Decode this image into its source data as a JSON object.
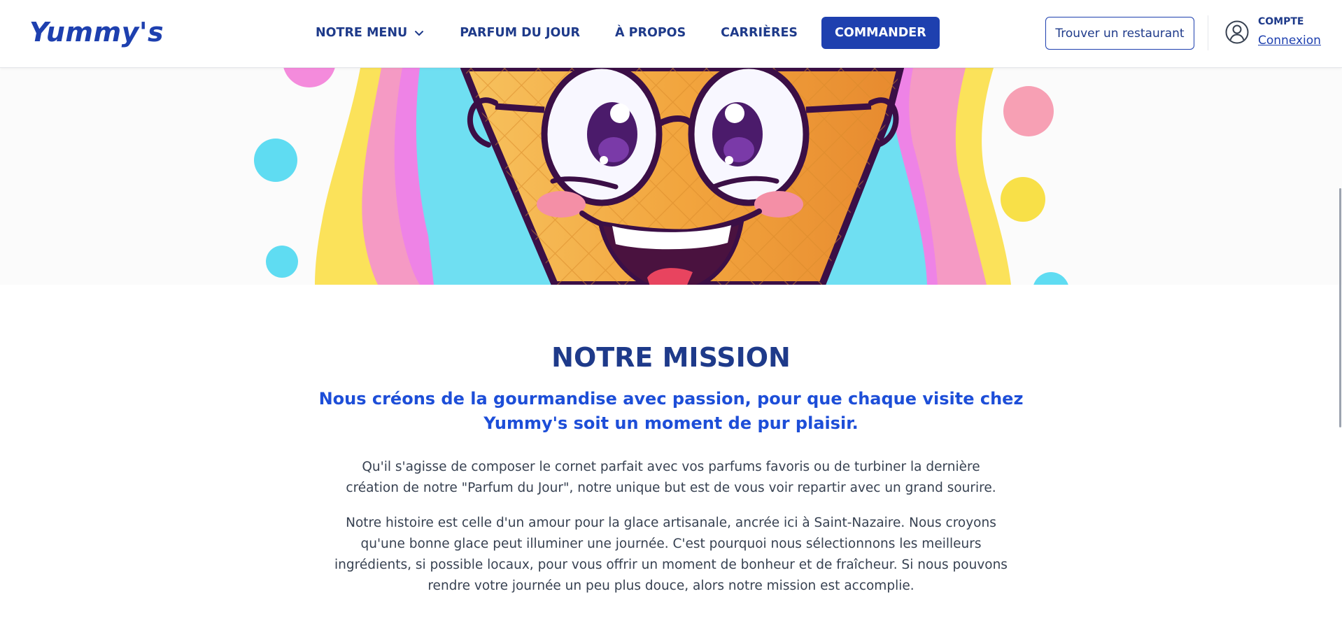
{
  "header": {
    "logo": "Yummy's",
    "nav": {
      "menu": "NOTRE MENU",
      "parfum": "PARFUM DU JOUR",
      "apropos": "À PROPOS",
      "carrieres": "CARRIÈRES"
    },
    "commander": "COMMANDER",
    "find_restaurant": "Trouver un restaurant",
    "account_label": "COMPTE",
    "account_link": "Connexion"
  },
  "hero": {
    "image": "ice-cream-cone-mascot-illustration",
    "colors": {
      "cone": "#f2a53e",
      "outline": "#3b0f46",
      "cyan": "#6fdff2",
      "pink": "#f59ac4",
      "yellow": "#fbe25a",
      "magenta": "#ee83e6"
    }
  },
  "mission": {
    "title": "NOTRE MISSION",
    "subtitle": "Nous créons de la gourmandise avec passion, pour que chaque visite chez Yummy's soit un moment de pur plaisir.",
    "paragraph1": "Qu'il s'agisse de composer le cornet parfait avec vos parfums favoris ou de turbiner la dernière création de notre \"Parfum du Jour\", notre unique but est de vous voir repartir avec un grand sourire.",
    "paragraph2": "Notre histoire est celle d'un amour pour la glace artisanale, ancrée ici à Saint-Nazaire. Nous croyons qu'une bonne glace peut illuminer une journée. C'est pourquoi nous sélectionnons les meilleurs ingrédients, si possible locaux, pour vous offrir un moment de bonheur et de fraîcheur. Si nous pouvons rendre votre journée un peu plus douce, alors notre mission est accomplie."
  },
  "theme": {
    "primary": "#1e40af",
    "primary_dark": "#1e3a8a",
    "accent_blue": "#1d4ed8"
  }
}
